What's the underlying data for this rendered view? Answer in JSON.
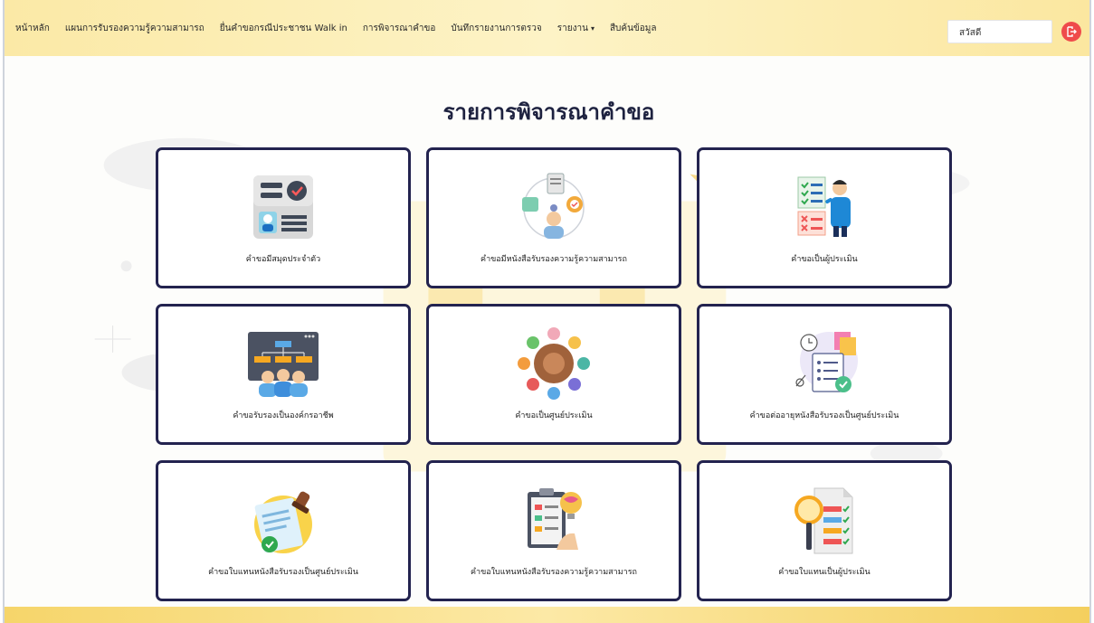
{
  "nav": {
    "items": [
      {
        "label": "หน้าหลัก"
      },
      {
        "label": "แผนการรับรองความรู้ความสามารถ"
      },
      {
        "label": "ยื่นคำขอกรณีประชาชน Walk in"
      },
      {
        "label": "การพิจารณาคำขอ"
      },
      {
        "label": "บันทึกรายงานการตรวจ"
      },
      {
        "label": "รายงาน"
      },
      {
        "label": "สืบค้นข้อมูล"
      }
    ],
    "dropdown_caret": "▾",
    "greeting": "สวัสดี"
  },
  "page": {
    "title": "รายการพิจารณาคำขอ"
  },
  "cards": [
    {
      "label": "คำขอมีสมุดประจำตัว",
      "icon": "id-card-icon"
    },
    {
      "label": "คำขอมีหนังสือรับรองความรู้ความสามารถ",
      "icon": "certificate-network-icon"
    },
    {
      "label": "คำขอเป็นผู้ประเมิน",
      "icon": "assessor-checklist-icon"
    },
    {
      "label": "คำขอรับรองเป็นองค์กรอาชีพ",
      "icon": "organization-chart-icon"
    },
    {
      "label": "คำขอเป็นศูนย์ประเมิน",
      "icon": "teamwork-circle-icon"
    },
    {
      "label": "คำขอต่ออายุหนังสือรับรองเป็นศูนย์ประเมิน",
      "icon": "renewal-document-icon"
    },
    {
      "label": "คำขอใบแทนหนังสือรับรองเป็นศูนย์ประเมิน",
      "icon": "stamped-document-icon"
    },
    {
      "label": "คำขอใบแทนหนังสือรับรองความรู้ความสามารถ",
      "icon": "clipboard-idea-icon"
    },
    {
      "label": "คำขอใบแทนเป็นผู้ประเมิน",
      "icon": "search-checklist-icon"
    }
  ],
  "colors": {
    "navbar": "#fdf0bb",
    "card_border": "#23234f",
    "title": "#1e2240",
    "logout": "#ef4b4b"
  }
}
